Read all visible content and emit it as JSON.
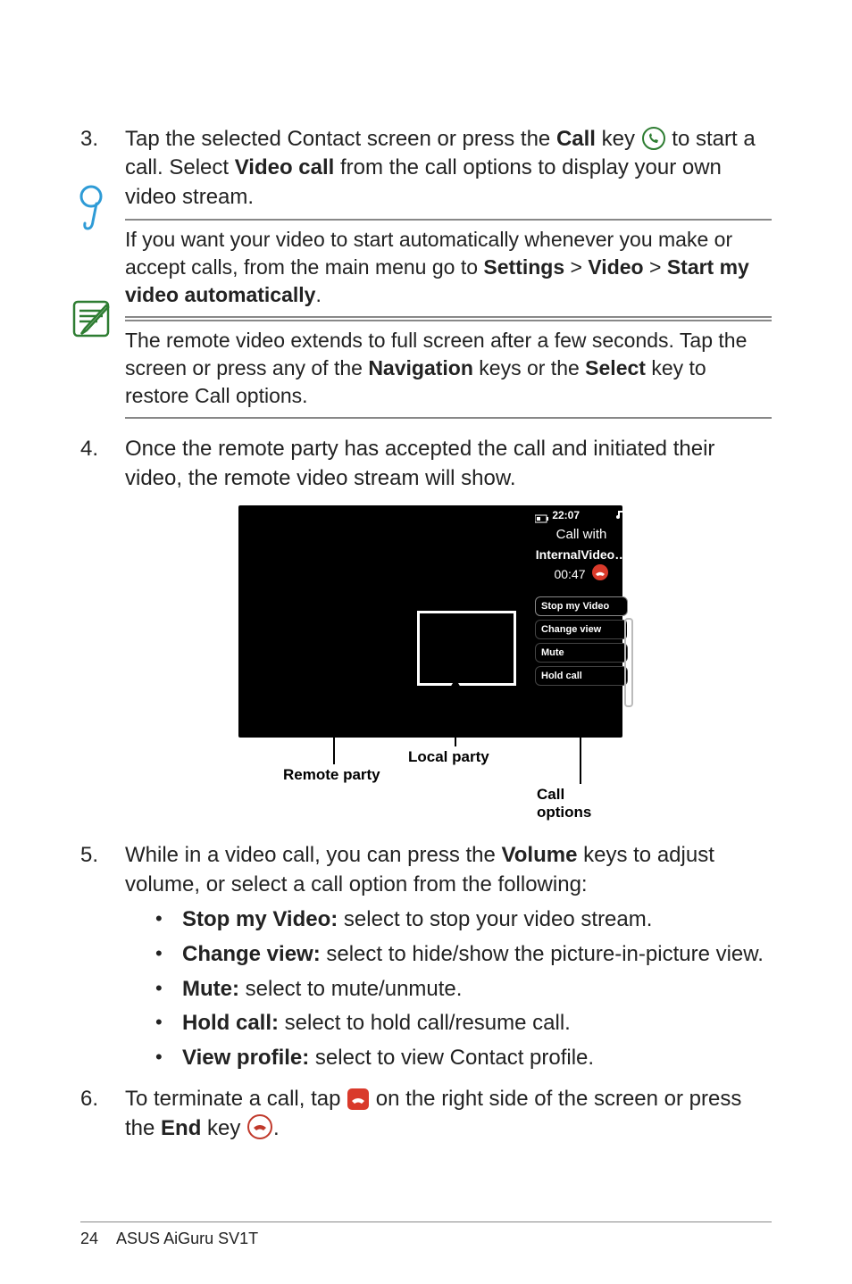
{
  "step3": {
    "num": "3.",
    "text_1": "Tap the selected Contact screen or press the ",
    "b_call": "Call",
    "text_2": " key ",
    "text_3": " to start a call. Select ",
    "b_videocall": "Video call",
    "text_4": " from the call options to display your own video stream."
  },
  "tip": {
    "t1": "If you want your video to start automatically whenever you make or accept calls, from the main menu go to ",
    "b_settings": "Settings",
    "gt1": " > ",
    "b_video": "Video",
    "gt2": " > ",
    "b_start": "Start my video automatically",
    "dot": "."
  },
  "note": {
    "t1": "The remote video extends to full screen after a few seconds. Tap the screen or press any of the ",
    "b_nav": "Navigation",
    "t2": " keys or the ",
    "b_sel": "Select",
    "t3": " key to restore Call options."
  },
  "step4": {
    "num": "4.",
    "text": "Once the remote party has accepted the call and initiated their video, the remote video stream will show."
  },
  "figure": {
    "status_batt": "🔲 22:07",
    "call_with": "Call with",
    "internal": "InternalVideo…",
    "timer": "00:47",
    "opt1": "Stop my Video",
    "opt2": "Change view",
    "opt3": "Mute",
    "opt4": "Hold call",
    "lbl_local": "Local party",
    "lbl_remote": "Remote party",
    "lbl_callopt": "Call options"
  },
  "step5": {
    "num": "5.",
    "t1": "While in a video call, you can press the ",
    "b_vol": "Volume",
    "t2": " keys to adjust volume, or select a call option from the following:",
    "items": [
      {
        "b": "Stop my Video:",
        "t": " select to stop your video stream."
      },
      {
        "b": "Change view:",
        "t": " select to hide/show the picture-in-picture view."
      },
      {
        "b": "Mute:",
        "t": " select to mute/unmute."
      },
      {
        "b": "Hold call:",
        "t": " select to hold call/resume call."
      },
      {
        "b": "View profile:",
        "t": " select to view Contact profile."
      }
    ]
  },
  "step6": {
    "num": "6.",
    "t1": "To terminate a call, tap ",
    "t2": " on the right side of the screen or press the ",
    "b_end": "End",
    "t3": " key ",
    "dot": "."
  },
  "footer": {
    "page": "24",
    "title": "ASUS AiGuru SV1T"
  }
}
